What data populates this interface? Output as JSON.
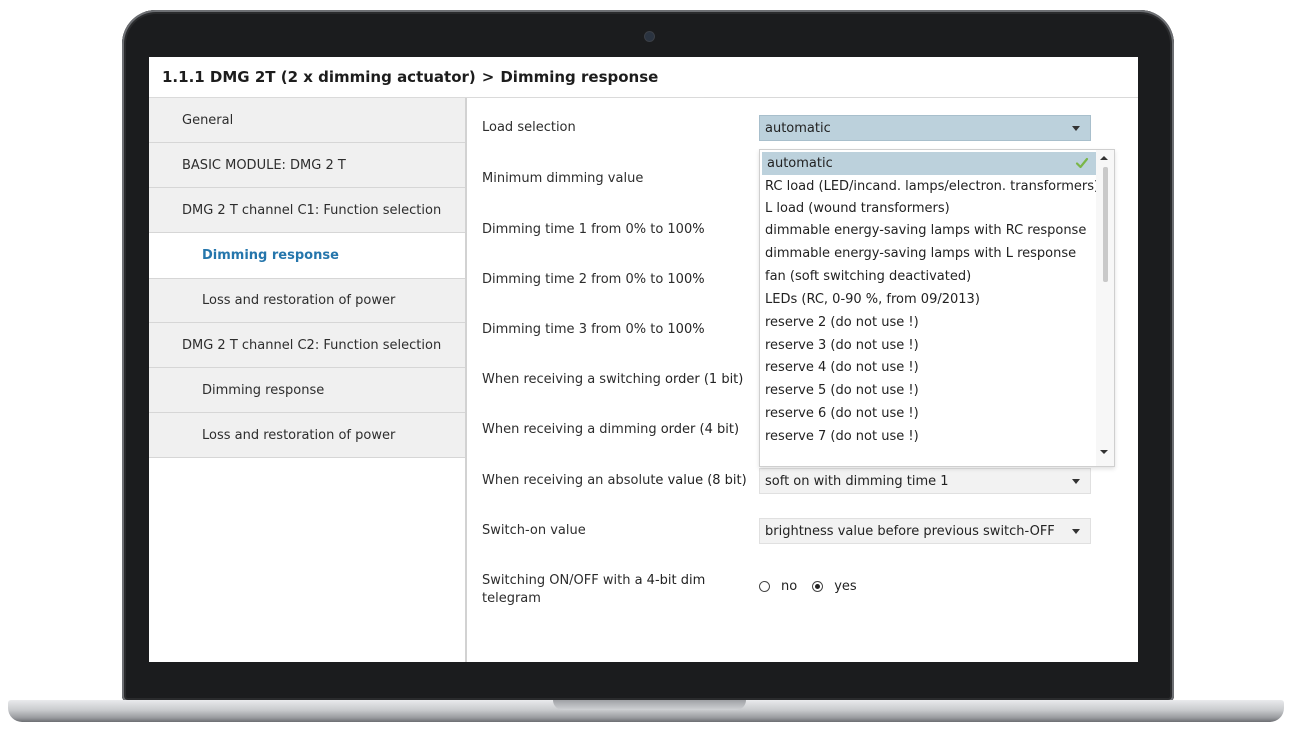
{
  "breadcrumb": {
    "device": "1.1.1 DMG 2T (2 x dimming actuator)",
    "separator": ">",
    "page": "Dimming response"
  },
  "sidebar": {
    "items": [
      {
        "label": "General"
      },
      {
        "label": "BASIC MODULE: DMG 2 T"
      },
      {
        "label": "DMG 2 T channel C1: Function selection"
      },
      {
        "label": "Dimming response",
        "active": true
      },
      {
        "label": "Loss and restoration of power"
      },
      {
        "label": "DMG 2 T channel C2: Function selection"
      },
      {
        "label": "Dimming response"
      },
      {
        "label": "Loss and restoration of power"
      }
    ]
  },
  "params": {
    "load_selection": {
      "label": "Load selection",
      "value": "automatic"
    },
    "min_dimming": {
      "label": "Minimum dimming value"
    },
    "dim_time_1": {
      "label": "Dimming time 1 from 0% to 100%"
    },
    "dim_time_2": {
      "label": "Dimming time 2 from 0% to 100%"
    },
    "dim_time_3": {
      "label": "Dimming time 3 from 0% to 100%"
    },
    "switching_order": {
      "label": "When receiving a switching order (1 bit)"
    },
    "dimming_order": {
      "label": "When receiving a dimming order (4 bit)"
    },
    "absolute_value": {
      "label": "When receiving an absolute value (8 bit)",
      "value": "soft on with dimming time 1"
    },
    "switch_on_value": {
      "label": "Switch-on value",
      "value": "brightness value before previous switch-OFF"
    },
    "switching_4bit": {
      "label_line1": "Switching ON/OFF with a 4-bit dim",
      "label_line2": "telegram",
      "options": [
        "no",
        "yes"
      ],
      "selected": "yes"
    }
  },
  "dropdown": {
    "options": [
      "automatic",
      "RC load (LED/incand. lamps/electron. transformers)",
      "L load (wound transformers)",
      "dimmable energy-saving lamps with RC response",
      "dimmable energy-saving lamps with L response",
      "fan (soft switching deactivated)",
      "LEDs (RC, 0-90 %, from 09/2013)",
      "reserve 2 (do not use !)",
      "reserve 3 (do not use !)",
      "reserve 4 (do not use !)",
      "reserve 5 (do not use !)",
      "reserve 6 (do not use !)",
      "reserve 7 (do not use !)"
    ],
    "selected_index": 0
  },
  "colors": {
    "accent": "#1a6fa8",
    "selection": "#bcd1dc",
    "check": "#7ab648"
  },
  "icons": {
    "check": "check-icon",
    "dropdown_arrow": "chevron-down-icon"
  }
}
